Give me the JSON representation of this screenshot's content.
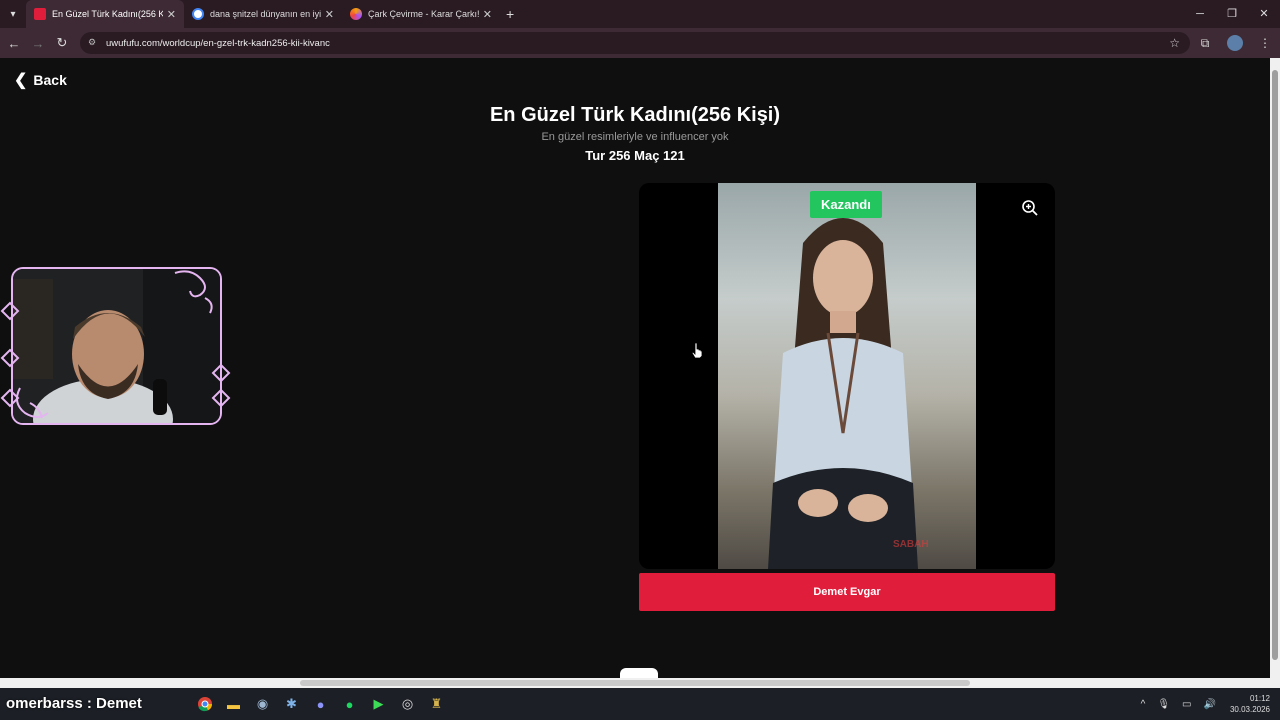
{
  "browser": {
    "tabs": [
      {
        "title": "En Güzel Türk Kadını(256 Kişi) |",
        "active": true,
        "favicon_color": "#e11d3c"
      },
      {
        "title": "dana şnitzel dünyanın en iyi yer",
        "active": false,
        "favicon_color": "#4285f4"
      },
      {
        "title": "Çark Çevirme - Karar Çarkı!",
        "active": false,
        "favicon_color": "#a855f7"
      }
    ],
    "new_tab": "+",
    "url": "uwufufu.com/worldcup/en-gzel-trk-kadn256-kii-kivanc"
  },
  "page": {
    "back_label": "Back",
    "title": "En Güzel Türk Kadını(256 Kişi)",
    "subtitle": "En güzel resimleriyle ve influencer yok",
    "round": "Tur 256 Maç 121",
    "badge": "Kazandı",
    "choice_label": "Demet Evgar",
    "watermark": "SABAH"
  },
  "stream_overlay": {
    "text": "omerbarss : Demet"
  },
  "taskbar": {
    "time": "01:12",
    "date": "30.03.2026",
    "icons": [
      "chrome-icon",
      "file-explorer-icon",
      "steam-icon",
      "app-icon",
      "discord-icon",
      "spotify-icon",
      "media-player-icon",
      "obs-icon",
      "game-icon"
    ]
  },
  "colors": {
    "accent_red": "#e11d3c",
    "badge_green": "#22c55e",
    "frame_lilac": "#e4b5f0"
  }
}
